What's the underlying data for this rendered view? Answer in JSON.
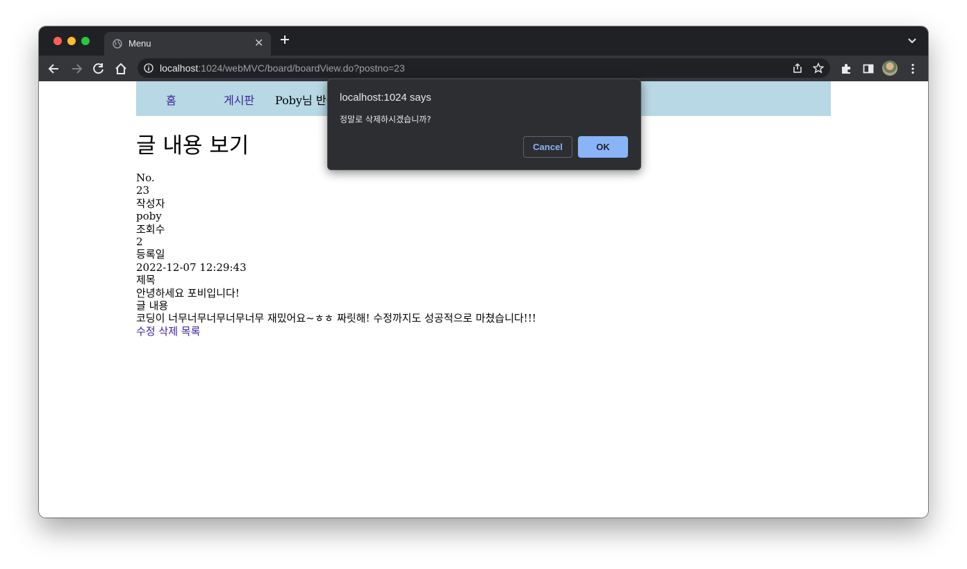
{
  "browser": {
    "tab_title": "Menu",
    "url_host": "localhost",
    "url_rest": ":1024/webMVC/board/boardView.do?postno=23"
  },
  "nav": {
    "home": "홈",
    "board": "게시판",
    "welcome": "Poby님 반갑"
  },
  "page": {
    "title": "글 내용 보기",
    "fields": [
      {
        "label": "No.",
        "value": "23"
      },
      {
        "label": "작성자",
        "value": "poby"
      },
      {
        "label": "조회수",
        "value": "2"
      },
      {
        "label": "등록일",
        "value": "2022-12-07 12:29:43"
      },
      {
        "label": "제목",
        "value": "안녕하세요 포비입니다!"
      },
      {
        "label": "글 내용",
        "value": "코딩이 너무너무너무너무너무 재밌어요~ㅎㅎ 짜릿해! 수정까지도 성공적으로 마쳤습니다!!!"
      }
    ],
    "actions": {
      "edit": "수정",
      "delete": "삭제",
      "list": "목록"
    }
  },
  "dialog": {
    "title": "localhost:1024 says",
    "message": "정말로 삭제하시겠습니까?",
    "cancel": "Cancel",
    "ok": "OK"
  },
  "colors": {
    "navbar_bg": "#b7d8e4",
    "link": "#3c1f9b",
    "dialog_bg": "#2d2e31",
    "ok_button": "#8ab4f8"
  },
  "icons": [
    "globe-icon",
    "close-icon",
    "plus-icon",
    "chevron-down-icon",
    "back-icon",
    "forward-icon",
    "reload-icon",
    "home-icon",
    "info-icon",
    "share-icon",
    "star-icon",
    "puzzle-icon",
    "sidepanel-icon",
    "more-icon"
  ]
}
